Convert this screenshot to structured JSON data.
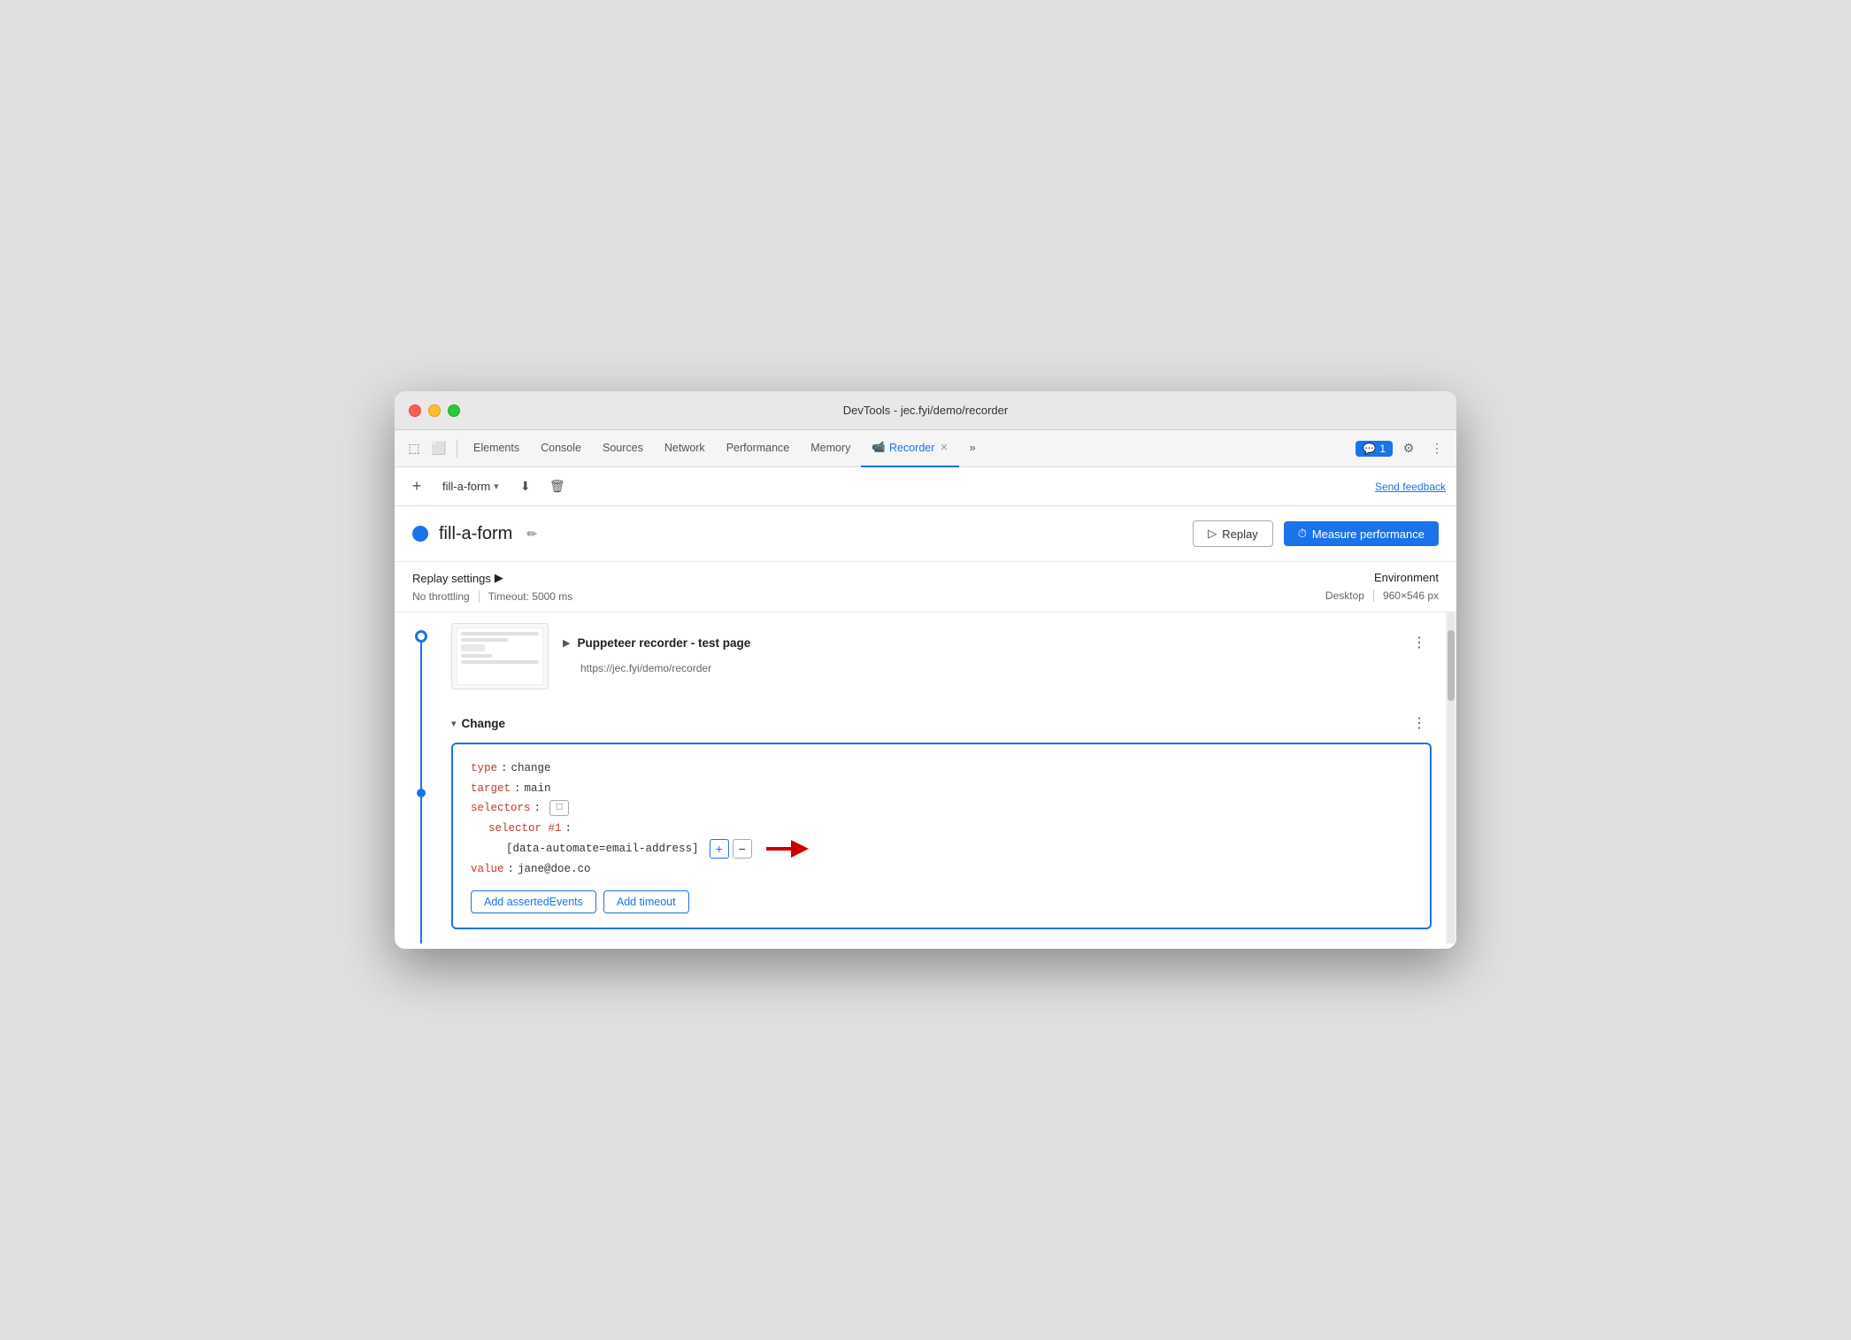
{
  "window": {
    "title": "DevTools - jec.fyi/demo/recorder"
  },
  "tabs": {
    "items": [
      {
        "id": "elements",
        "label": "Elements",
        "active": false
      },
      {
        "id": "console",
        "label": "Console",
        "active": false
      },
      {
        "id": "sources",
        "label": "Sources",
        "active": false
      },
      {
        "id": "network",
        "label": "Network",
        "active": false
      },
      {
        "id": "performance",
        "label": "Performance",
        "active": false
      },
      {
        "id": "memory",
        "label": "Memory",
        "active": false
      },
      {
        "id": "recorder",
        "label": "Recorder",
        "active": true
      }
    ],
    "more_label": "»",
    "chat_count": "1",
    "chat_icon": "💬"
  },
  "toolbar": {
    "add_label": "+",
    "recording_name": "fill-a-form",
    "dropdown_icon": "▾",
    "export_icon": "⬇",
    "delete_icon": "🗑",
    "send_feedback": "Send feedback"
  },
  "recording": {
    "dot_color": "#1a73e8",
    "title": "fill-a-form",
    "edit_icon": "✏",
    "replay_label": "Replay",
    "replay_icon": "▷",
    "measure_label": "Measure performance",
    "measure_icon": "⏱"
  },
  "replay_settings": {
    "title": "Replay settings",
    "arrow": "▶",
    "throttling": "No throttling",
    "timeout": "Timeout: 5000 ms",
    "environment_title": "Environment",
    "viewport": "Desktop",
    "size": "960×546 px"
  },
  "steps": {
    "step1": {
      "title": "Puppeteer recorder - test page",
      "url": "https://jec.fyi/demo/recorder",
      "expand_icon": "▶",
      "more_icon": "⋮"
    },
    "step2": {
      "title": "Change",
      "expand_icon": "▾",
      "more_icon": "⋮",
      "code": {
        "type_key": "type",
        "type_value": "change",
        "target_key": "target",
        "target_value": "main",
        "selectors_key": "selectors",
        "selector_num_key": "selector #1",
        "selector_value": "[data-automate=email-address]",
        "value_key": "value",
        "value_value": "jane@doe.co"
      },
      "add_asserted_label": "Add assertedEvents",
      "add_timeout_label": "Add timeout"
    }
  }
}
